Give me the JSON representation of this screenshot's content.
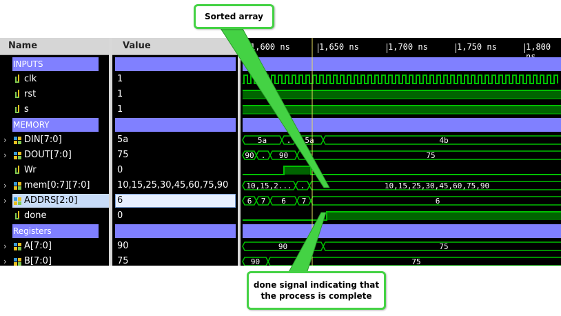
{
  "columns": {
    "name": "Name",
    "value": "Value"
  },
  "timeline": {
    "ticks": [
      "1,600 ns",
      "1,650 ns",
      "1,700 ns",
      "1,750 ns",
      "1,800 ns"
    ]
  },
  "signals": [
    {
      "id": "inputs",
      "name": "INPUTS",
      "type": "group",
      "value": ""
    },
    {
      "id": "clk",
      "name": "clk",
      "type": "bit",
      "value": "1"
    },
    {
      "id": "rst",
      "name": "rst",
      "type": "bit",
      "value": "1"
    },
    {
      "id": "s",
      "name": "s",
      "type": "bit",
      "value": "1"
    },
    {
      "id": "memory",
      "name": "MEMORY",
      "type": "group",
      "value": ""
    },
    {
      "id": "din",
      "name": "DIN[7:0]",
      "type": "bus",
      "value": "5a"
    },
    {
      "id": "dout",
      "name": "DOUT[7:0]",
      "type": "bus",
      "value": "75"
    },
    {
      "id": "wr",
      "name": "Wr",
      "type": "bit",
      "value": "0"
    },
    {
      "id": "mem",
      "name": "mem[0:7][7:0]",
      "type": "bus",
      "value": "10,15,25,30,45,60,75,90"
    },
    {
      "id": "addrs",
      "name": "ADDRS[2:0]",
      "type": "bus",
      "value": "6",
      "selected": true
    },
    {
      "id": "done",
      "name": "done",
      "type": "bit",
      "value": "0"
    },
    {
      "id": "registers",
      "name": "Registers",
      "type": "group",
      "value": ""
    },
    {
      "id": "a",
      "name": "A[7:0]",
      "type": "bus",
      "value": "90"
    },
    {
      "id": "b",
      "name": "B[7:0]",
      "type": "bus",
      "value": "75"
    }
  ],
  "wave_labels": {
    "din": [
      "5a",
      ".",
      "5a",
      "4b"
    ],
    "dout": [
      "90",
      ".",
      "90",
      "75"
    ],
    "mem": [
      "10,15,2...",
      ".",
      "10,15,25,30,45,60,75,90"
    ],
    "addrs": [
      "6",
      "7",
      "6",
      "7",
      "6"
    ],
    "a": [
      "90",
      "75"
    ],
    "b": [
      "90",
      "75"
    ]
  },
  "callouts": {
    "sorted": "Sorted array",
    "done_line1": "done signal indicating that",
    "done_line2": "the process is complete"
  },
  "colors": {
    "wave_green": "#00c000",
    "group_purple": "#8080ff",
    "cursor_yellow": "#e8e060",
    "callout_border": "#44d244"
  }
}
